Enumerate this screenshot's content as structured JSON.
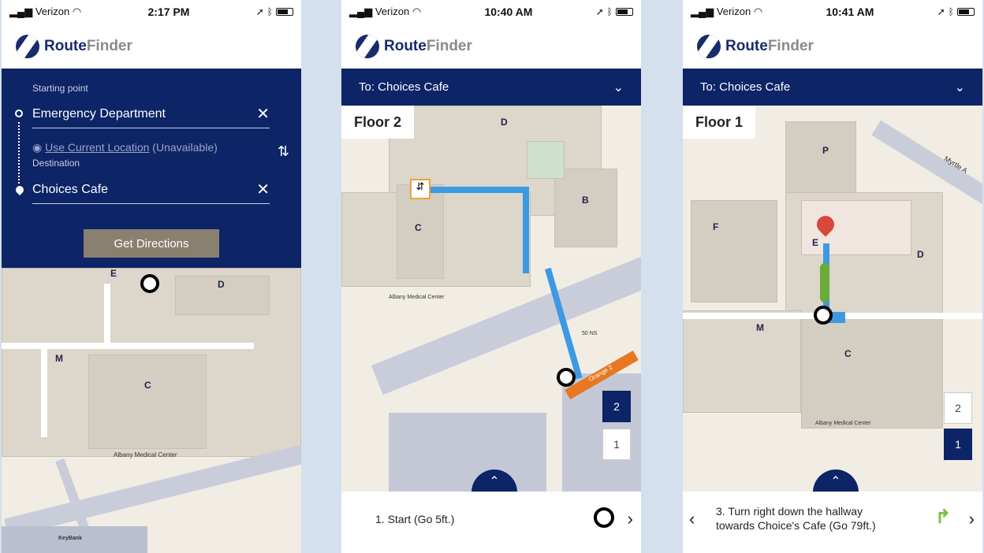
{
  "screens": [
    {
      "status": {
        "carrier": "Verizon",
        "time": "2:17 PM"
      },
      "brand": {
        "route": "Route",
        "finder": "Finder"
      },
      "form": {
        "starting_label": "Starting point",
        "start_value": "Emergency Department",
        "current_location_link": "Use Current Location",
        "current_location_status": "(Unavailable)",
        "destination_label": "Destination",
        "destination_value": "Choices Cafe",
        "get_directions": "Get Directions"
      },
      "map": {
        "labels": {
          "e": "E",
          "d": "D",
          "m": "M",
          "c": "C"
        },
        "center": "Albany Medical Center",
        "keybank": "KeyBank"
      }
    },
    {
      "status": {
        "carrier": "Verizon",
        "time": "10:40 AM"
      },
      "brand": {
        "route": "Route",
        "finder": "Finder"
      },
      "destination": "To: Choices Cafe",
      "floor_badge": "Floor 2",
      "map": {
        "labels": {
          "d": "D",
          "b": "B",
          "c": "C"
        },
        "center": "Albany Medical Center",
        "garage": "50 NS",
        "orange_road": "Orange 2"
      },
      "floors": [
        "2",
        "1"
      ],
      "active_floor": "2",
      "step": "1. Start (Go 5ft.)"
    },
    {
      "status": {
        "carrier": "Verizon",
        "time": "10:41 AM"
      },
      "brand": {
        "route": "Route",
        "finder": "Finder"
      },
      "destination": "To: Choices Cafe",
      "floor_badge": "Floor 1",
      "map": {
        "labels": {
          "p": "P",
          "f": "F",
          "e": "E",
          "d": "D",
          "m": "M",
          "c": "C"
        },
        "center": "Albany Medical Center",
        "street": "Myrtle A"
      },
      "floors": [
        "2",
        "1"
      ],
      "active_floor": "1",
      "step_line1": "3. Turn right down the hallway",
      "step_line2": "towards Choice's Cafe (Go 79ft.)"
    }
  ]
}
